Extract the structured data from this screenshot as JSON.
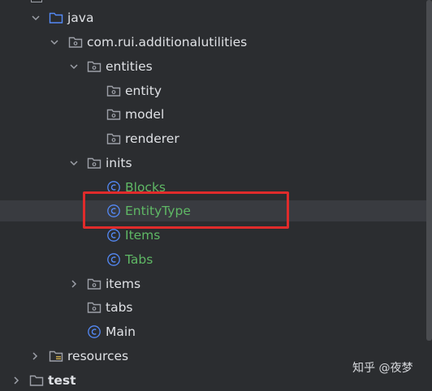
{
  "tree": {
    "items": [
      {
        "label": "java",
        "icon": "folder-icon",
        "chevron": "down",
        "color": "#dfe1e5"
      },
      {
        "label": "com.rui.additionalutilities",
        "icon": "package-icon",
        "chevron": "down",
        "color": "#dfe1e5"
      },
      {
        "label": "entities",
        "icon": "package-icon",
        "chevron": "down",
        "color": "#dfe1e5"
      },
      {
        "label": "entity",
        "icon": "package-icon",
        "chevron": "none",
        "color": "#dfe1e5"
      },
      {
        "label": "model",
        "icon": "package-icon",
        "chevron": "none",
        "color": "#dfe1e5"
      },
      {
        "label": "renderer",
        "icon": "package-icon",
        "chevron": "none",
        "color": "#dfe1e5"
      },
      {
        "label": "inits",
        "icon": "package-icon",
        "chevron": "down",
        "color": "#dfe1e5"
      },
      {
        "label": "Blocks",
        "icon": "class-icon",
        "chevron": "none",
        "color": "#5fb865"
      },
      {
        "label": "EntityType",
        "icon": "class-icon",
        "chevron": "none",
        "color": "#5fb865",
        "selected": true
      },
      {
        "label": "Items",
        "icon": "class-icon",
        "chevron": "none",
        "color": "#5fb865"
      },
      {
        "label": "Tabs",
        "icon": "class-icon",
        "chevron": "none",
        "color": "#5fb865"
      },
      {
        "label": "items",
        "icon": "package-icon",
        "chevron": "right",
        "color": "#dfe1e5"
      },
      {
        "label": "tabs",
        "icon": "package-icon",
        "chevron": "none",
        "color": "#dfe1e5"
      },
      {
        "label": "Main",
        "icon": "class-icon",
        "chevron": "none",
        "color": "#dfe1e5"
      },
      {
        "label": "resources",
        "icon": "resources-folder-icon",
        "chevron": "right",
        "color": "#dfe1e5"
      },
      {
        "label": "test",
        "icon": "folder-icon",
        "chevron": "right",
        "color": "#dfe1e5"
      }
    ]
  },
  "watermark": "知乎 @夜梦",
  "colors": {
    "background": "#2b2d30",
    "selection": "#393b40",
    "class_label": "#5fb865",
    "class_icon": "#548af7",
    "highlight_box": "#e02b2b"
  }
}
